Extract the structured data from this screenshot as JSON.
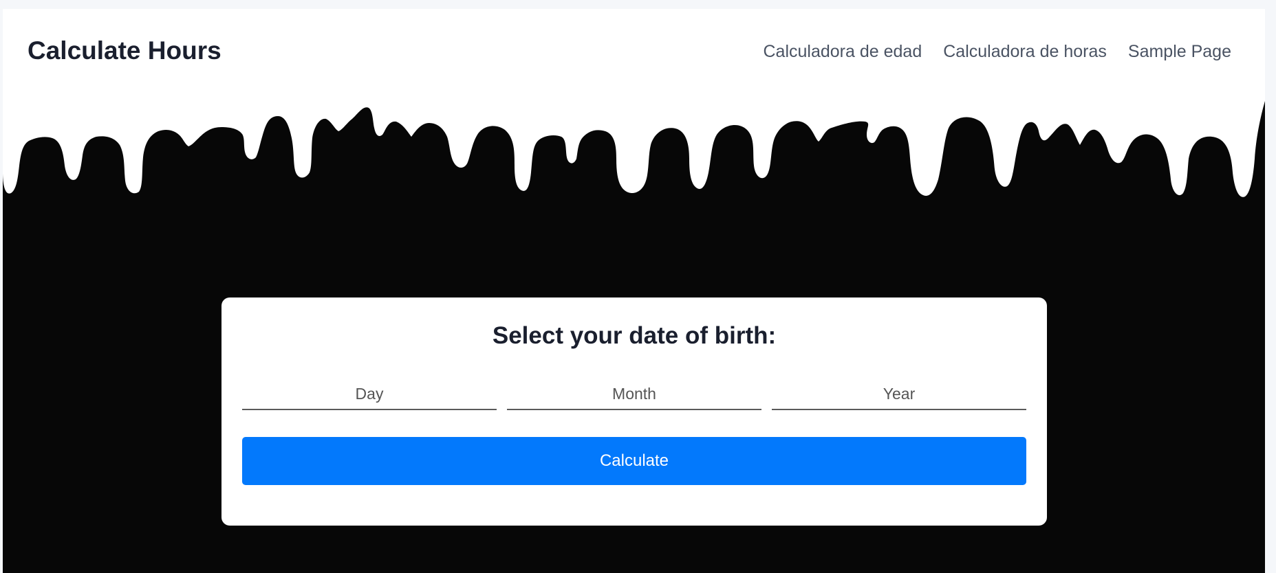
{
  "header": {
    "site_title": "Calculate Hours",
    "nav": [
      {
        "label": "Calculadora de edad"
      },
      {
        "label": "Calculadora de horas"
      },
      {
        "label": "Sample Page"
      }
    ]
  },
  "form": {
    "title": "Select your date of birth:",
    "day": {
      "placeholder": "Day",
      "value": ""
    },
    "month": {
      "placeholder": "Month",
      "value": ""
    },
    "year": {
      "placeholder": "Year",
      "value": ""
    },
    "submit_label": "Calculate"
  },
  "colors": {
    "accent": "#0379fc",
    "hero_background": "#070707",
    "card_background": "#ffffff",
    "title_text": "#1a1f2e",
    "nav_text": "#4a5363"
  }
}
